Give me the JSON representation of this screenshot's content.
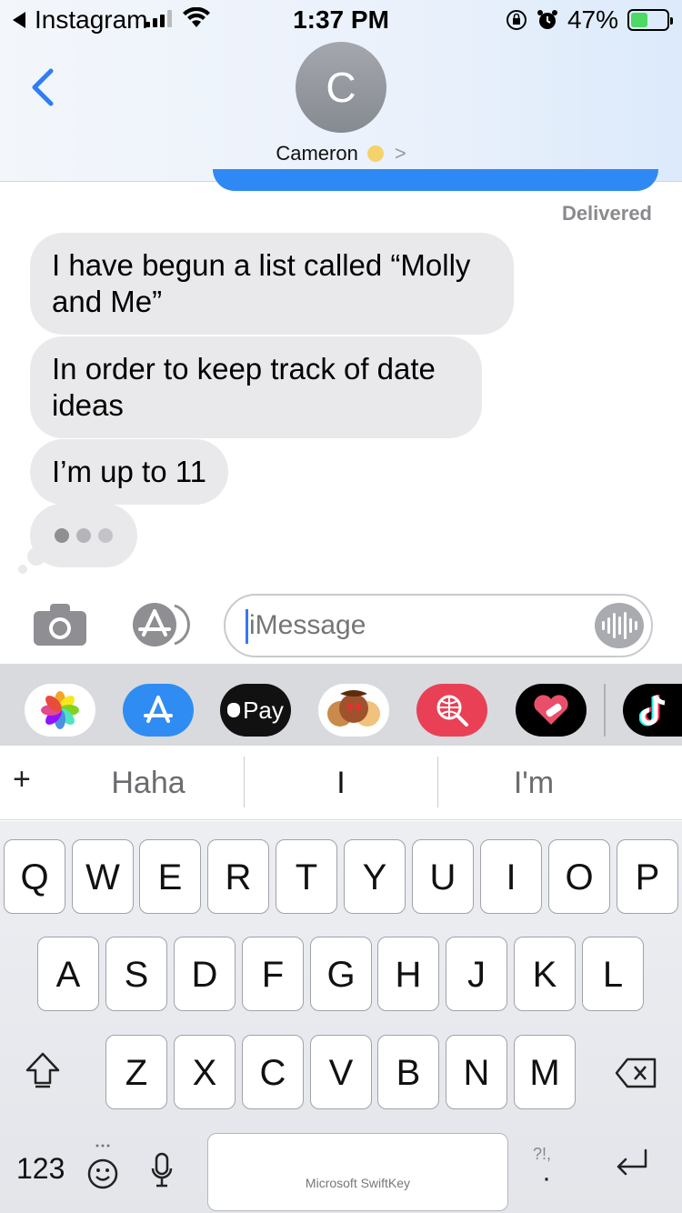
{
  "status_bar": {
    "back_app": "Instagram",
    "time": "1:37 PM",
    "battery": "47%",
    "battery_level": 0.47
  },
  "contact": {
    "initial": "C",
    "name": "Cameron"
  },
  "messages": {
    "delivered": "Delivered",
    "incoming": [
      "I have begun a list called “Molly and Me”",
      "In order to keep track of date ideas",
      "I’m up to 11"
    ]
  },
  "composer": {
    "placeholder": "iMessage"
  },
  "app_drawer": {
    "apps": [
      "Photos",
      "App Store",
      "Apple Pay",
      "Memoji",
      "Search",
      "Heart",
      "TikTok"
    ],
    "apple_pay_label": "Pay"
  },
  "suggestions": {
    "plus": "+",
    "items": [
      "Haha",
      "I",
      "I'm"
    ]
  },
  "keyboard": {
    "row1": [
      "Q",
      "W",
      "E",
      "R",
      "T",
      "Y",
      "U",
      "I",
      "O",
      "P"
    ],
    "row2": [
      "A",
      "S",
      "D",
      "F",
      "G",
      "H",
      "J",
      "K",
      "L"
    ],
    "row3": [
      "Z",
      "X",
      "C",
      "V",
      "B",
      "N",
      "M"
    ],
    "numbers_label": "123",
    "space_label": "Microsoft SwiftKey",
    "punct_hint": "?!,"
  },
  "colors": {
    "bubble_incoming": "#e9e9eb",
    "bubble_outgoing": "#2f89f5",
    "accent": "#3478f6"
  }
}
